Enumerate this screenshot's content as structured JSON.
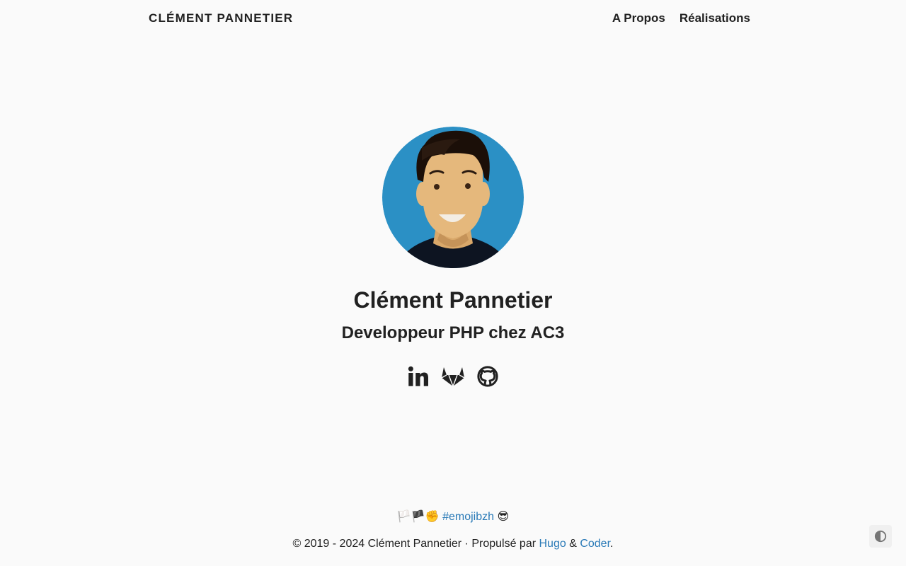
{
  "navbar": {
    "brand": "CLÉMENT PANNETIER",
    "links": [
      {
        "label": "A Propos"
      },
      {
        "label": "Réalisations"
      }
    ]
  },
  "profile": {
    "name": "Clément Pannetier",
    "tagline": "Developpeur PHP chez AC3",
    "avatar_bg_color": "#2b90c5",
    "socials": [
      {
        "icon": "linkedin-icon"
      },
      {
        "icon": "gitlab-icon"
      },
      {
        "icon": "github-icon"
      }
    ]
  },
  "footer": {
    "emoji_prefix": "🏳️🏴✊",
    "hashtag": "#emojibzh",
    "emoji_suffix": "😎",
    "copyright": "© 2019 - 2024 Clément Pannetier · Propulsé par",
    "hugo_label": "Hugo",
    "amp": "&",
    "coder_label": "Coder",
    "period": "."
  },
  "colors": {
    "background": "#fafafa",
    "text": "#212121",
    "link": "#2a7ab7"
  }
}
